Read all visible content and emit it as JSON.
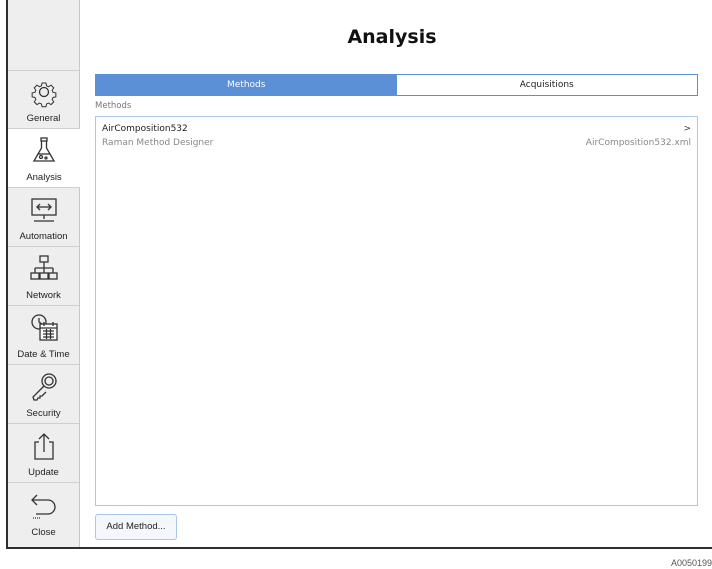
{
  "header": {
    "title": "Analysis"
  },
  "sidebar": {
    "items": [
      {
        "label": "General",
        "icon": "gear-icon"
      },
      {
        "label": "Analysis",
        "icon": "flask-icon",
        "active": true
      },
      {
        "label": "Automation",
        "icon": "monitor-arrows-icon"
      },
      {
        "label": "Network",
        "icon": "network-icon"
      },
      {
        "label": "Date & Time",
        "icon": "clock-calendar-icon"
      },
      {
        "label": "Security",
        "icon": "key-icon"
      },
      {
        "label": "Update",
        "icon": "upload-icon"
      },
      {
        "label": "Close",
        "icon": "back-arrow-icon"
      }
    ]
  },
  "tabs": [
    {
      "label": "Methods",
      "active": true
    },
    {
      "label": "Acquisitions",
      "active": false
    }
  ],
  "methods": {
    "section_label": "Methods",
    "items": [
      {
        "name": "AirComposition532",
        "subtitle": "Raman Method Designer",
        "file": "AirComposition532.xml",
        "chevron": ">"
      }
    ]
  },
  "actions": {
    "add_method_label": "Add Method..."
  },
  "figure_id": "A0050199",
  "colors": {
    "accent": "#5b8fd6",
    "list_border": "#a9c7ea",
    "sidebar_bg": "#eeeeee"
  }
}
